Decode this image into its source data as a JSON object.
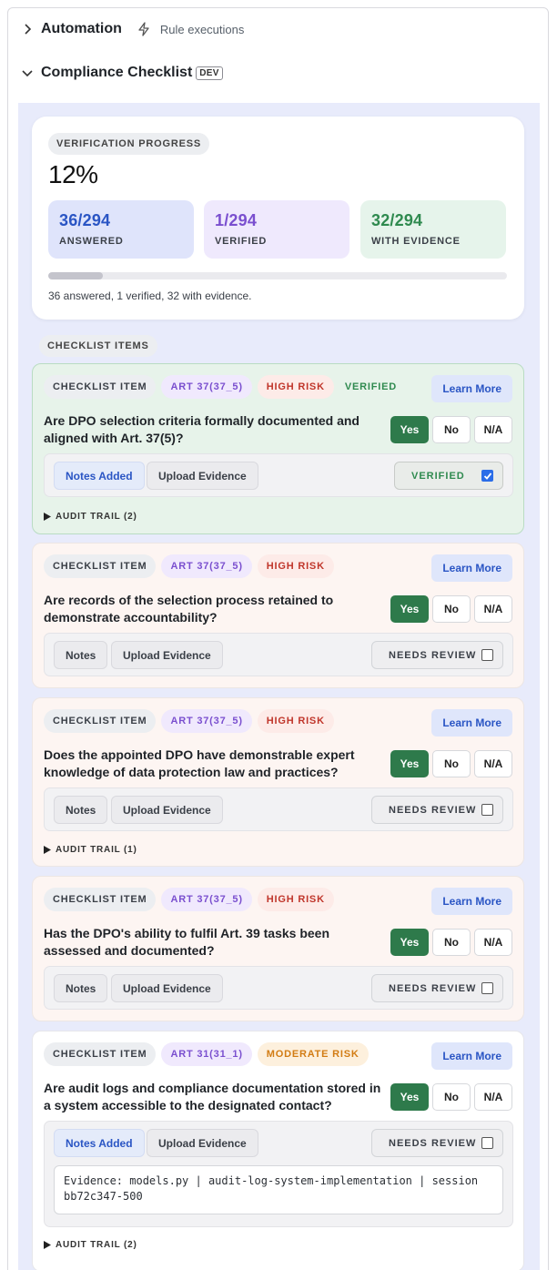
{
  "automation": {
    "title": "Automation",
    "subtitle": "Rule executions"
  },
  "checklist_section": {
    "title": "Compliance Checklist",
    "badge": "DEV"
  },
  "progress": {
    "label": "VERIFICATION PROGRESS",
    "percent_text": "12%",
    "percent_value": 0.12,
    "stats": [
      {
        "value": "36/294",
        "label": "ANSWERED",
        "color": "#2a55c4",
        "bg": "#dfe4fb"
      },
      {
        "value": "1/294",
        "label": "VERIFIED",
        "color": "#7a4fcf",
        "bg": "#efe9fd"
      },
      {
        "value": "32/294",
        "label": "WITH EVIDENCE",
        "color": "#2f8a4f",
        "bg": "#e6f4eb"
      }
    ],
    "summary": "36 answered, 1 verified, 32 with evidence."
  },
  "items_label": "CHECKLIST ITEMS",
  "common": {
    "tag_item": "CHECKLIST ITEM",
    "learn_more": "Learn More",
    "yes": "Yes",
    "no": "No",
    "na": "N/A",
    "upload": "Upload Evidence"
  },
  "items": [
    {
      "article": "ART 37(37_5)",
      "risk": "HIGH RISK",
      "verified_tag": "VERIFIED",
      "question": "Are DPO selection criteria formally documented and aligned with Art. 37(5)?",
      "notes": "Notes Added",
      "status": "VERIFIED",
      "checked": true,
      "audit": "AUDIT TRAIL (2)"
    },
    {
      "article": "ART 37(37_5)",
      "risk": "HIGH RISK",
      "question": "Are records of the selection process retained to demonstrate accountability?",
      "notes": "Notes",
      "status": "NEEDS REVIEW",
      "checked": false
    },
    {
      "article": "ART 37(37_5)",
      "risk": "HIGH RISK",
      "question": "Does the appointed DPO have demonstrable expert knowledge of data protection law and practices?",
      "notes": "Notes",
      "status": "NEEDS REVIEW",
      "checked": false,
      "audit": "AUDIT TRAIL (1)"
    },
    {
      "article": "ART 37(37_5)",
      "risk": "HIGH RISK",
      "question": "Has the DPO's ability to fulfil Art. 39 tasks been assessed and documented?",
      "notes": "Notes",
      "status": "NEEDS REVIEW",
      "checked": false
    },
    {
      "article": "ART 31(31_1)",
      "risk": "MODERATE RISK",
      "question": "Are audit logs and compliance documentation stored in a system accessible to the designated contact?",
      "notes": "Notes Added",
      "status": "NEEDS REVIEW",
      "checked": false,
      "evidence": "Evidence: models.py | audit-log-system-implementation | session bb72c347-500",
      "audit": "AUDIT TRAIL (2)"
    }
  ]
}
